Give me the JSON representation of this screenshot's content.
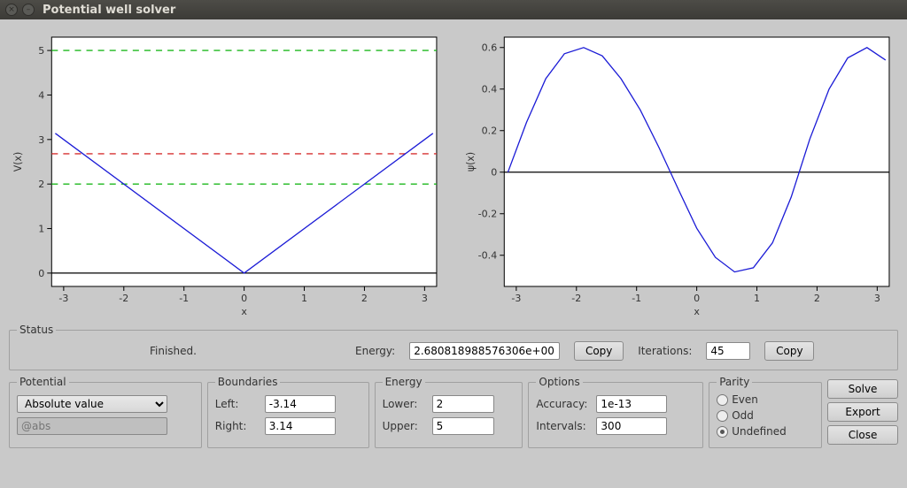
{
  "window": {
    "title": "Potential well solver"
  },
  "status": {
    "legend": "Status",
    "message": "Finished.",
    "energy_label": "Energy:",
    "energy_value": "2.680818988576306e+00",
    "copy1": "Copy",
    "iterations_label": "Iterations:",
    "iterations_value": "45",
    "copy2": "Copy"
  },
  "potential": {
    "legend": "Potential",
    "selected": "Absolute value",
    "expr_placeholder": "@abs"
  },
  "boundaries": {
    "legend": "Boundaries",
    "left_label": "Left:",
    "left_value": "-3.14",
    "right_label": "Right:",
    "right_value": "3.14"
  },
  "energy": {
    "legend": "Energy",
    "lower_label": "Lower:",
    "lower_value": "2",
    "upper_label": "Upper:",
    "upper_value": "5"
  },
  "options": {
    "legend": "Options",
    "accuracy_label": "Accuracy:",
    "accuracy_value": "1e-13",
    "intervals_label": "Intervals:",
    "intervals_value": "300"
  },
  "parity": {
    "legend": "Parity",
    "even": "Even",
    "odd": "Odd",
    "undefined": "Undefined",
    "selected": "undefined"
  },
  "actions": {
    "solve": "Solve",
    "export": "Export",
    "close": "Close"
  },
  "chart_data": [
    {
      "type": "line",
      "title": "",
      "xlabel": "x",
      "ylabel": "V(x)",
      "xlim": [
        -3.2,
        3.2
      ],
      "ylim": [
        -0.3,
        5.3
      ],
      "xticks": [
        -3,
        -2,
        -1,
        0,
        1,
        2,
        3
      ],
      "yticks": [
        0,
        1,
        2,
        3,
        4,
        5
      ],
      "series": [
        {
          "name": "V(x)=|x|",
          "color": "#1b1bd6",
          "x": [
            -3.14,
            0,
            3.14
          ],
          "y": [
            3.14,
            0,
            3.14
          ]
        }
      ],
      "hlines": [
        {
          "y": 5.0,
          "color": "#1db81d",
          "dash": true
        },
        {
          "y": 2.68,
          "color": "#d63030",
          "dash": true
        },
        {
          "y": 2.0,
          "color": "#1db81d",
          "dash": true
        },
        {
          "y": 0.0,
          "color": "#000000",
          "dash": false
        }
      ]
    },
    {
      "type": "line",
      "title": "",
      "xlabel": "x",
      "ylabel": "ψ(x)",
      "xlim": [
        -3.2,
        3.2
      ],
      "ylim": [
        -0.55,
        0.65
      ],
      "xticks": [
        -3,
        -2,
        -1,
        0,
        1,
        2,
        3
      ],
      "yticks": [
        -0.4,
        -0.2,
        0.0,
        0.2,
        0.4,
        0.6
      ],
      "hlines": [
        {
          "y": 0.0,
          "color": "#000000",
          "dash": false
        }
      ],
      "series": [
        {
          "name": "ψ(x)",
          "color": "#1b1bd6",
          "x": [
            -3.14,
            -2.83,
            -2.51,
            -2.2,
            -1.88,
            -1.57,
            -1.26,
            -0.94,
            -0.63,
            -0.31,
            0,
            0.31,
            0.63,
            0.94,
            1.26,
            1.57,
            1.88,
            2.2,
            2.51,
            2.83,
            3.14
          ],
          "y": [
            0.0,
            0.24,
            0.45,
            0.57,
            0.6,
            0.56,
            0.45,
            0.3,
            0.12,
            -0.08,
            -0.27,
            -0.41,
            -0.48,
            -0.46,
            -0.34,
            -0.12,
            0.16,
            0.4,
            0.55,
            0.6,
            0.54
          ]
        }
      ]
    }
  ]
}
